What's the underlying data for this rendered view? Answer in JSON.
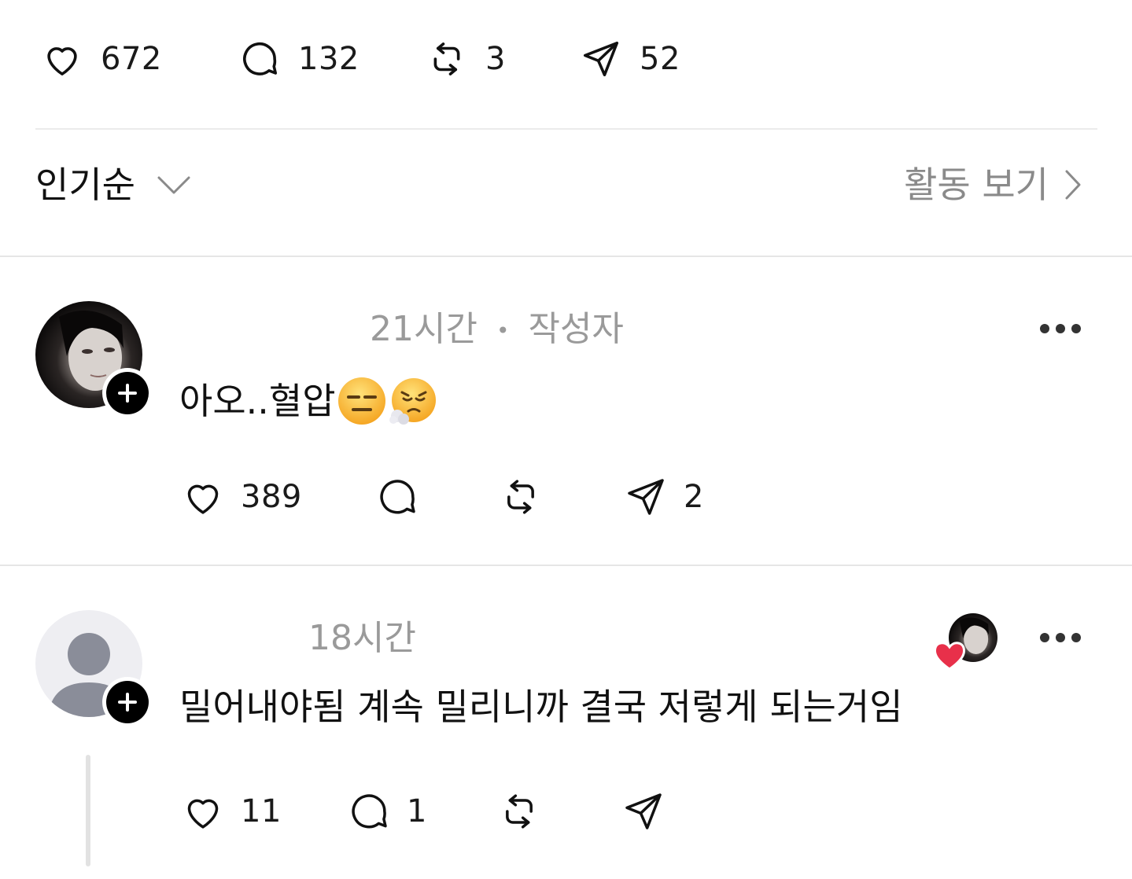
{
  "post_actions": {
    "like_count": "672",
    "comment_count": "132",
    "repost_count": "3",
    "share_count": "52"
  },
  "controls": {
    "sort_label": "인기순",
    "activity_label": "활동 보기"
  },
  "replies": [
    {
      "time": "21시간",
      "separator": "•",
      "author_tag": "작성자",
      "text": "아오..혈압",
      "emojis": [
        "expressionless-face",
        "face-with-steam"
      ],
      "like_count": "389",
      "comment_count": "",
      "repost_count": "",
      "share_count": "2"
    },
    {
      "time": "18시간",
      "text": "밀어내야됨 계속 밀리니까 결국 저렇게 되는거임",
      "liked_by_author": true,
      "like_count": "11",
      "comment_count": "1",
      "repost_count": "",
      "share_count": ""
    }
  ],
  "colors": {
    "text": "#111111",
    "muted": "#9a9a9a",
    "divider": "#e6e6e6",
    "heart_red": "#e8304a"
  }
}
